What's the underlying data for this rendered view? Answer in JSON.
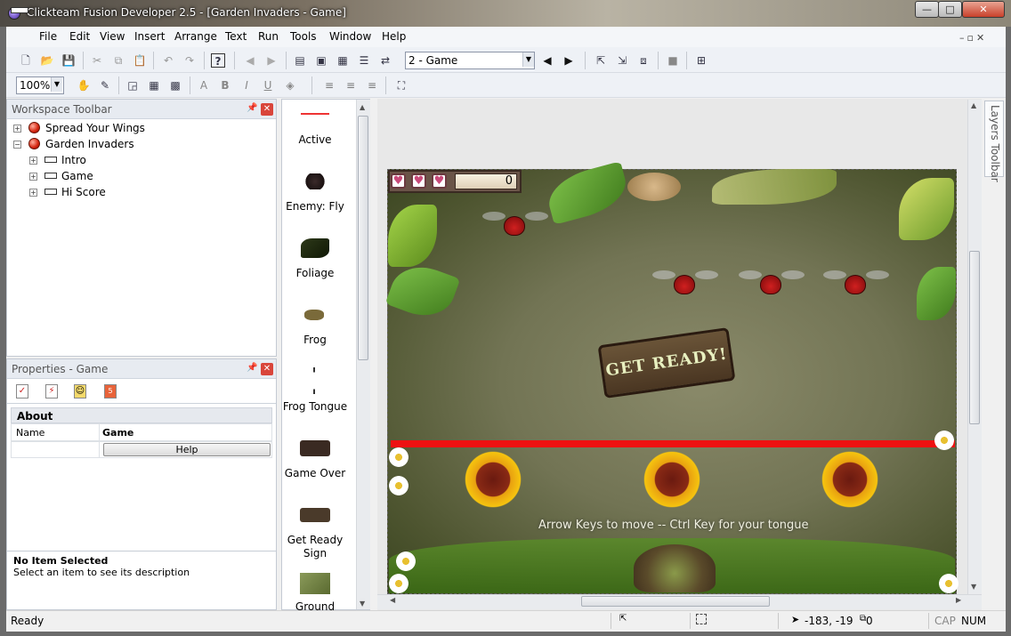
{
  "window": {
    "title": "Clickteam Fusion Developer 2.5 - [Garden Invaders - Game]",
    "min_label": "—",
    "max_label": "□",
    "close_label": "✕"
  },
  "menubar": {
    "items": [
      "File",
      "Edit",
      "View",
      "Insert",
      "Arrange",
      "Text",
      "Run",
      "Tools",
      "Window",
      "Help"
    ]
  },
  "toolbar": {
    "frame_select": "2 - Game",
    "zoom": "100%",
    "bold": "B",
    "italic": "I",
    "underline": "U"
  },
  "workspace": {
    "title": "Workspace Toolbar",
    "tree": [
      {
        "label": "Spread Your Wings",
        "type": "app"
      },
      {
        "label": "Garden Invaders",
        "type": "app"
      },
      {
        "label": "Intro",
        "type": "frame"
      },
      {
        "label": "Game",
        "type": "frame"
      },
      {
        "label": "Hi Score",
        "type": "frame"
      }
    ]
  },
  "properties": {
    "title": "Properties - Game",
    "section": "About",
    "rows": [
      {
        "name": "Name",
        "value": "Game"
      }
    ],
    "help_button": "Help",
    "desc_title": "No Item Selected",
    "desc_text": "Select an item to see its description"
  },
  "objects": {
    "items": [
      "Active",
      "Enemy: Fly",
      "Foliage",
      "Frog",
      "Frog Tongue",
      "Game Over",
      "Get Ready Sign",
      "Ground"
    ]
  },
  "game": {
    "score": "0",
    "get_ready": "Get ready!",
    "instruction": "Arrow Keys to move -- Ctrl Key for your tongue"
  },
  "layers": {
    "label": "Layers Toolbar"
  },
  "status": {
    "text": "Ready",
    "coords": "-183, -19",
    "size": "0",
    "cap": "CAP",
    "num": "NUM"
  },
  "colors": {
    "red_line": "#ee1111",
    "accent": "#d9453a"
  }
}
